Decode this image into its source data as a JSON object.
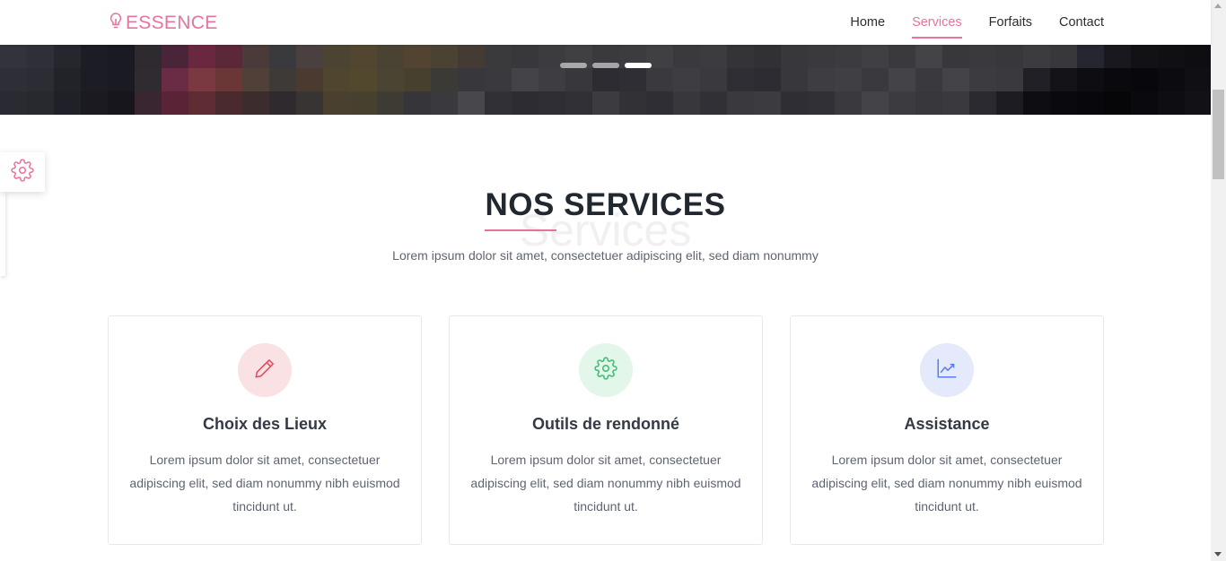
{
  "brand": {
    "name": "ESSENCE",
    "icon": "lightbulb-icon",
    "color": "#e8739a"
  },
  "nav": {
    "items": [
      {
        "label": "Home",
        "active": false
      },
      {
        "label": "Services",
        "active": true
      },
      {
        "label": "Forfaits",
        "active": false
      },
      {
        "label": "Contact",
        "active": false
      }
    ]
  },
  "hero": {
    "slides_total": 3,
    "active_slide": 3
  },
  "settings": {
    "icon": "gear-icon"
  },
  "section": {
    "background_word": "Services",
    "title": "NOS SERVICES",
    "subtitle": "Lorem ipsum dolor sit amet, consectetuer adipiscing elit, sed diam nonummy"
  },
  "services": [
    {
      "title": "Choix des Lieux",
      "text": "Lorem ipsum dolor sit amet, consectetuer adipiscing elit, sed diam nonummy nibh euismod tincidunt ut.",
      "icon": "pencil-icon",
      "color": "#e04a5c",
      "bg": "#fae1e4"
    },
    {
      "title": "Outils de rendonné",
      "text": "Lorem ipsum dolor sit amet, consectetuer adipiscing elit, sed diam nonummy nibh euismod tincidunt ut.",
      "icon": "gear-icon",
      "color": "#3dbb73",
      "bg": "#e2f6ea"
    },
    {
      "title": "Assistance",
      "text": "Lorem ipsum dolor sit amet, consectetuer adipiscing elit, sed diam nonummy nibh euismod tincidunt ut.",
      "icon": "chart-line-icon",
      "color": "#5b7ee8",
      "bg": "#e4e9fb"
    }
  ]
}
